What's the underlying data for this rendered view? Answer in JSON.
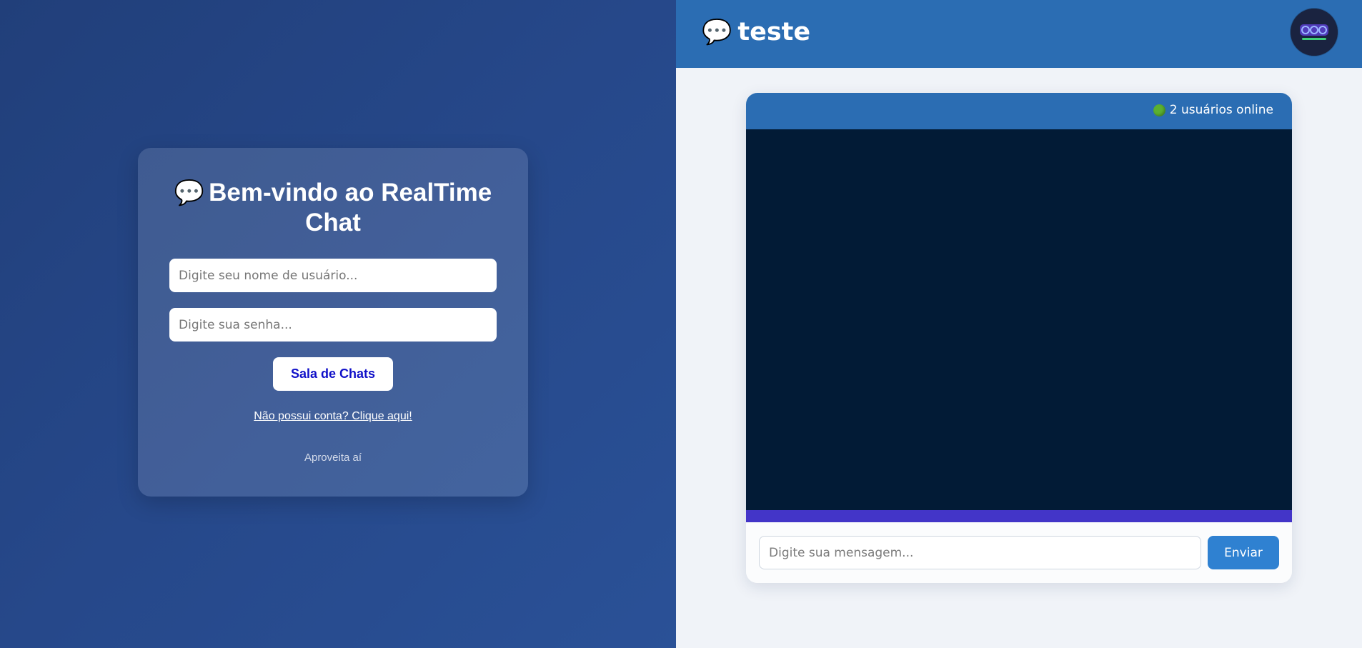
{
  "login": {
    "title_icon": "speech-bubble-icon",
    "title_emoji": "💬",
    "title": "Bem-vindo ao RealTime Chat",
    "username_placeholder": "Digite seu nome de usuário...",
    "password_placeholder": "Digite sua senha...",
    "submit_label": "Sala de Chats",
    "signup_link": "Não possui conta? Clique aqui!",
    "footer_note": "Aproveita aí"
  },
  "chat": {
    "room_icon": "speech-bubble-icon",
    "room_emoji": "💬",
    "room_name": "teste",
    "avatar_icon": "user-avatar-logo",
    "online_icon": "green-circle-icon",
    "online_count_text": "2 usuários online",
    "message_placeholder": "Digite sua mensagem...",
    "send_label": "Enviar"
  },
  "colors": {
    "left_bg": "#26488a",
    "topbar": "#2b6db3",
    "messages_bg": "#021b36",
    "strip": "#4335c8",
    "send_button": "#2f81d1",
    "login_button_text": "#1010c8"
  }
}
